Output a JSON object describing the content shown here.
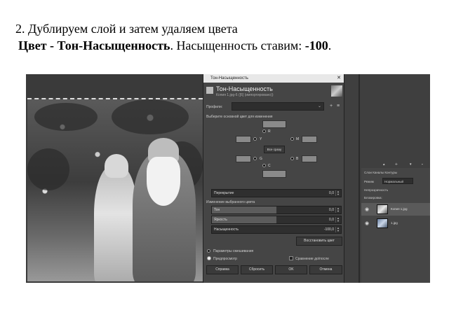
{
  "slide": {
    "heading": "2. Дублируем слой и затем удаляем цвета",
    "menu_path": "Цвет - Тон-Насыщенность",
    "instruction_mid": ". Насыщенность ставим: ",
    "saturation_value": "-100",
    "end_dot": "."
  },
  "dialog": {
    "window_title": "Тон-Насыщенность",
    "title": "Тон-Насыщенность",
    "subtitle": "Копия 1.jpg-6 ([6] (импортировано))",
    "presets_label": "Профили:",
    "primary_label": "Выберите основной цвет для изменения",
    "patches": {
      "r": "R",
      "y": "Y",
      "m": "M",
      "master": "Все сразу",
      "g": "G",
      "b": "B",
      "c": "C"
    },
    "overlap": {
      "label": "Перекрытие",
      "value": "0,0",
      "fraction": 0.0
    },
    "adjust_label": "Изменение выбранного цвета",
    "hue": {
      "label": "Тон",
      "value": "0,0",
      "fraction": 0.5
    },
    "lightness": {
      "label": "Яркость",
      "value": "0,0",
      "fraction": 0.5
    },
    "saturation": {
      "label": "Насыщенность",
      "value": "-100,0",
      "fraction": 0.0
    },
    "reset_color_button": "Восстановить цвет",
    "blend_label": "Параметры смешивания",
    "preview_label": "Предпросмотр",
    "split_view_label": "Сравнение до/после",
    "help_button": "Справка",
    "reset_button": "Сбросить",
    "ok_button": "OK",
    "cancel_button": "Отмена"
  },
  "dock": {
    "tabs_text": "Слои  Каналы  Контуры",
    "mode_label": "Режим",
    "mode_value": "Нормальный",
    "opacity_label": "Непрозрачность",
    "lock_label": "Блокировка:",
    "layers": [
      {
        "name": "Копия 1.jpg"
      },
      {
        "name": "1.jpg"
      }
    ]
  }
}
